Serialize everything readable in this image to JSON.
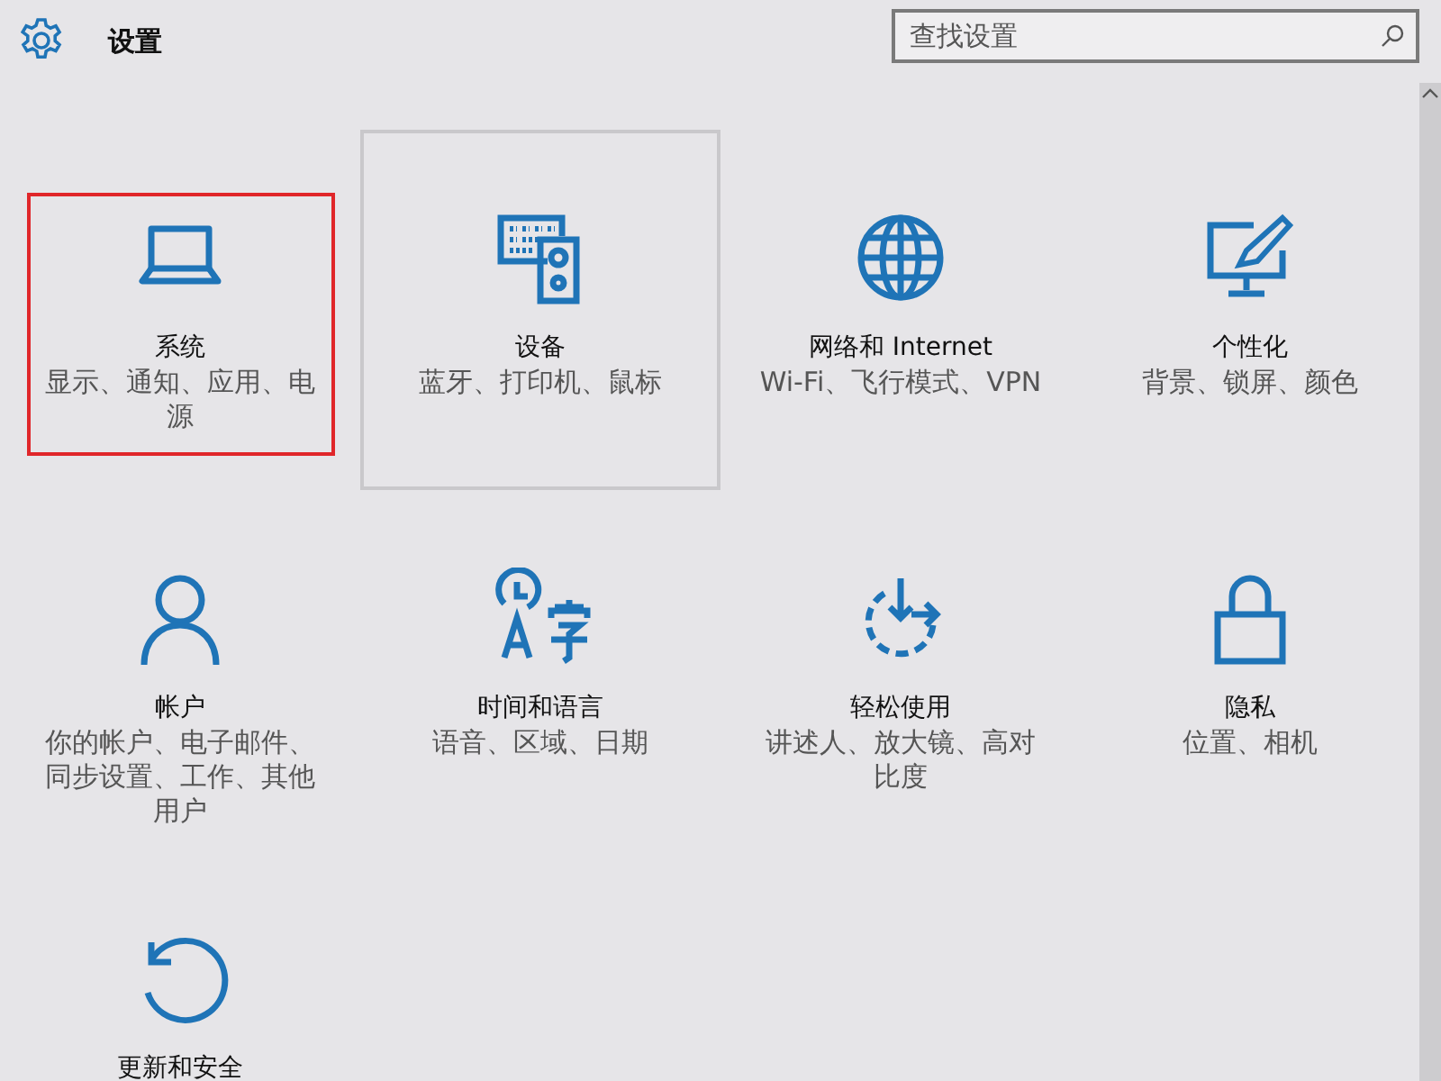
{
  "header": {
    "title": "设置"
  },
  "search": {
    "placeholder": "查找设置"
  },
  "tiles": [
    {
      "kind": "laptop",
      "title": "系统",
      "subtitle": "显示、通知、应用、电源",
      "highlighted": true,
      "hovered": false
    },
    {
      "kind": "devices",
      "title": "设备",
      "subtitle": "蓝牙、打印机、鼠标",
      "highlighted": false,
      "hovered": true
    },
    {
      "kind": "globe",
      "title": "网络和 Internet",
      "subtitle": "Wi-Fi、飞行模式、VPN",
      "highlighted": false,
      "hovered": false
    },
    {
      "kind": "paint",
      "title": "个性化",
      "subtitle": "背景、锁屏、颜色",
      "highlighted": false,
      "hovered": false
    },
    {
      "kind": "person",
      "title": "帐户",
      "subtitle": "你的帐户、电子邮件、同步设置、工作、其他用户",
      "highlighted": false,
      "hovered": false
    },
    {
      "kind": "language",
      "title": "时间和语言",
      "subtitle": "语音、区域、日期",
      "highlighted": false,
      "hovered": false
    },
    {
      "kind": "ease",
      "title": "轻松使用",
      "subtitle": "讲述人、放大镜、高对比度",
      "highlighted": false,
      "hovered": false
    },
    {
      "kind": "lock",
      "title": "隐私",
      "subtitle": "位置、相机",
      "highlighted": false,
      "hovered": false
    },
    {
      "kind": "update",
      "title": "更新和安全",
      "highlighted": false,
      "hovered": false
    }
  ]
}
